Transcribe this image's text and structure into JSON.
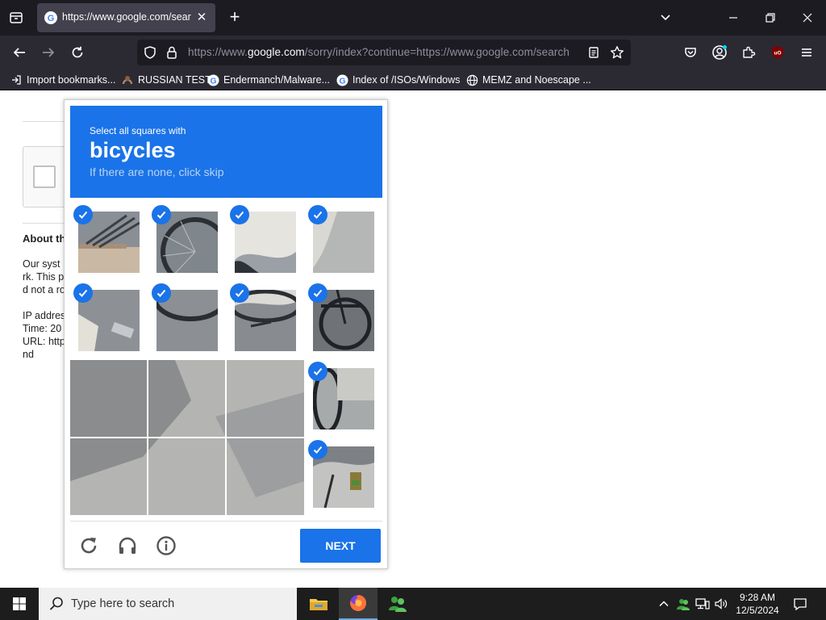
{
  "browser": {
    "tab": {
      "title": "https://www.google.com/search",
      "favicon": "google-g-icon"
    },
    "url": {
      "prefix": "https://www.",
      "host": "google.com",
      "rest": "/sorry/index?continue=https://www.google.com/search"
    },
    "bookmarks": [
      {
        "label": "Import bookmarks...",
        "icon": "import-icon"
      },
      {
        "label": "RUSSIAN TEST",
        "icon": "favicon-icon"
      },
      {
        "label": "Endermanch/Malware...",
        "icon": "google-g-icon"
      },
      {
        "label": "Index of /ISOs/Windows",
        "icon": "google-g-icon"
      },
      {
        "label": "MEMZ and Noescape ...",
        "icon": "globe-icon"
      }
    ],
    "extension_badge": "uO"
  },
  "page": {
    "about_heading": "About th",
    "lines": [
      "Our syst",
      "rk. This p",
      "d not a ro"
    ],
    "ip_lines": [
      "IP addres",
      "Time: 20",
      "URL: http",
      "nd"
    ]
  },
  "captcha": {
    "instruction": "Select all squares with",
    "target": "bicycles",
    "skip_hint": "If there are none, click skip",
    "next_label": "NEXT",
    "selected_count": 10,
    "accent": "#1a73e8"
  },
  "taskbar": {
    "search_placeholder": "Type here to search",
    "time": "9:28 AM",
    "date": "12/5/2024"
  }
}
